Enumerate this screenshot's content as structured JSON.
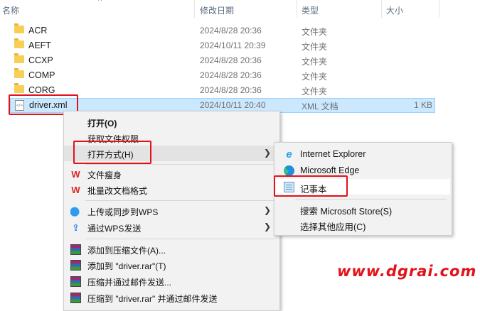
{
  "columns": {
    "name": "名称",
    "date": "修改日期",
    "type": "类型",
    "size": "大小"
  },
  "sort_caret": "^",
  "files": [
    {
      "name": "ACR",
      "date": "2024/8/28 20:36",
      "type": "文件夹",
      "size": ""
    },
    {
      "name": "AEFT",
      "date": "2024/10/11 20:39",
      "type": "文件夹",
      "size": ""
    },
    {
      "name": "CCXP",
      "date": "2024/8/28 20:36",
      "type": "文件夹",
      "size": ""
    },
    {
      "name": "COMP",
      "date": "2024/8/28 20:36",
      "type": "文件夹",
      "size": ""
    },
    {
      "name": "CORG",
      "date": "2024/8/28 20:36",
      "type": "文件夹",
      "size": ""
    }
  ],
  "selected_file": {
    "name": "driver.xml",
    "date": "2024/10/11 20:40",
    "type": "XML 文档",
    "size": "1 KB"
  },
  "context_menu": {
    "open": "打开(O)",
    "ownership": "获取文件权限",
    "open_with": "打开方式(H)",
    "wps_slim": "文件瘦身",
    "wps_batch": "批量改文档格式",
    "upload_wps": "上传或同步到WPS",
    "send_wps": "通过WPS发送",
    "add_archive": "添加到压缩文件(A)...",
    "add_rar": "添加到 \"driver.rar\"(T)",
    "compress_email": "压缩并通过邮件发送...",
    "compress_rar_email": "压缩到 \"driver.rar\" 并通过邮件发送"
  },
  "submenu": {
    "ie": "Internet Explorer",
    "edge": "Microsoft Edge",
    "notepad": "记事本",
    "store": "搜索 Microsoft Store(S)",
    "other": "选择其他应用(C)"
  },
  "watermark": "www.dgrai.com"
}
